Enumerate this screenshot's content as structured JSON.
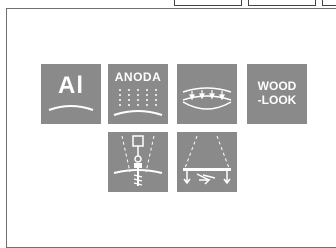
{
  "tiles": {
    "aluminium": {
      "label": "Al",
      "icon": "aluminium-symbol-icon"
    },
    "anodized": {
      "label": "ANODA",
      "icon": "anodized-surface-icon"
    },
    "bendable": {
      "icon": "curved-pressure-icon"
    },
    "wood_look": {
      "line1": "WOOD",
      "line2": "-LOOK",
      "icon": "wood-look-icon"
    },
    "screw_mount": {
      "icon": "screw-mounting-icon"
    },
    "flat_mount": {
      "icon": "flat-profile-mounting-icon"
    }
  },
  "colors": {
    "tile_bg": "#8a8a8a",
    "tile_fg": "#ffffff",
    "frame_border": "#6f6f6f"
  }
}
